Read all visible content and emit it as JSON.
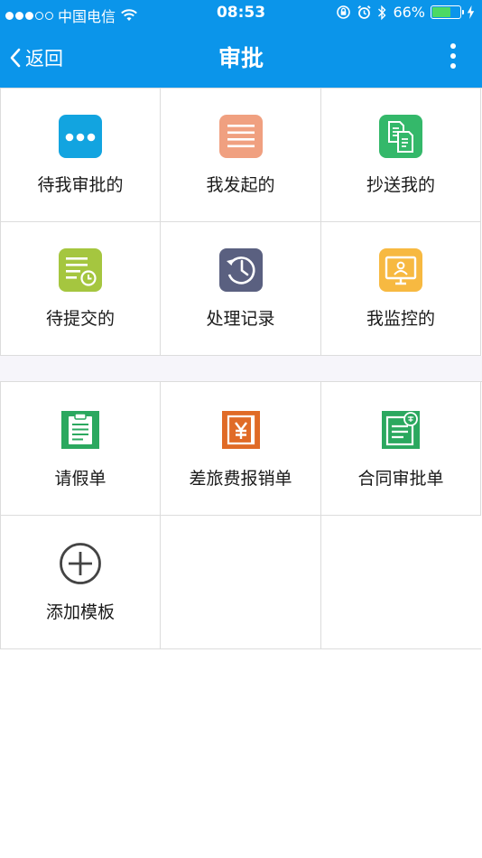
{
  "status_bar": {
    "carrier": "中国电信",
    "time": "08:53",
    "battery": "66%",
    "battery_level": 0.66
  },
  "navbar": {
    "back_label": "返回",
    "title": "审批"
  },
  "section1": [
    {
      "label": "待我审批的",
      "icon": "more-dots-icon",
      "color": "#12a4e0"
    },
    {
      "label": "我发起的",
      "icon": "list-lines-icon",
      "color": "#f0a080"
    },
    {
      "label": "抄送我的",
      "icon": "documents-icon",
      "color": "#34b86a"
    },
    {
      "label": "待提交的",
      "icon": "doc-clock-icon",
      "color": "#a5c63f"
    },
    {
      "label": "处理记录",
      "icon": "history-icon",
      "color": "#5a6080"
    },
    {
      "label": "我监控的",
      "icon": "monitor-user-icon",
      "color": "#f7b941"
    }
  ],
  "section2": [
    {
      "label": "请假单",
      "icon": "clipboard-icon",
      "color": "#2ba85f"
    },
    {
      "label": "差旅费报销单",
      "icon": "yen-receipt-icon",
      "color": "#e06b27"
    },
    {
      "label": "合同审批单",
      "icon": "contract-purchase-icon",
      "color": "#2ba85f"
    },
    {
      "label": "添加模板",
      "icon": "add-circle-icon",
      "color": "#444444"
    }
  ],
  "colors": {
    "header": "#0b95ea",
    "divider": "#dcdcdc",
    "section_gap": "#f6f5fa"
  }
}
